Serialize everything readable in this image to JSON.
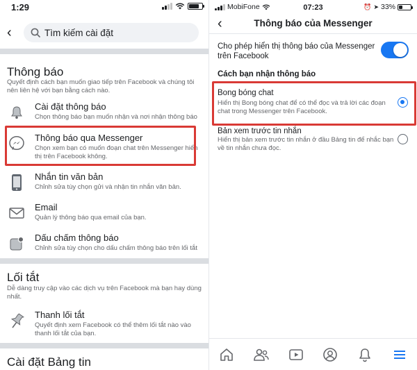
{
  "left": {
    "status": {
      "time": "1:29"
    },
    "search": {
      "placeholder": "Tìm kiếm cài đặt"
    },
    "notifications": {
      "title": "Thông báo",
      "description": "Quyết định cách bạn muốn giao tiếp trên Facebook và chúng tôi nên liên hệ với bạn bằng cách nào.",
      "items": [
        {
          "title": "Cài đặt thông báo",
          "desc": "Chọn thông báo bạn muốn nhận và nơi nhận thông báo",
          "icon": "bell-icon"
        },
        {
          "title": "Thông báo qua Messenger",
          "desc": "Chọn xem bạn có muốn đoạn chat trên Messenger hiển thị trên Facebook không.",
          "icon": "messenger-icon"
        },
        {
          "title": "Nhắn tin văn bản",
          "desc": "Chỉnh sửa tùy chọn gửi và nhận tin nhắn văn bản.",
          "icon": "phone-icon"
        },
        {
          "title": "Email",
          "desc": "Quản lý thông báo qua email của bạn.",
          "icon": "envelope-icon"
        },
        {
          "title": "Dấu chấm thông báo",
          "desc": "Chỉnh sửa tùy chọn cho dấu chấm thông báo trên lối tắt",
          "icon": "notification-dot-icon"
        }
      ]
    },
    "shortcuts": {
      "title": "Lối tắt",
      "description": "Dễ dàng truy cập vào các dịch vụ trên Facebook mà bạn hay dùng nhất.",
      "items": [
        {
          "title": "Thanh lối tắt",
          "desc": "Quyết định xem Facebook có thể thêm lối tắt nào vào thanh lối tắt của bạn.",
          "icon": "pin-icon"
        }
      ]
    },
    "news_feed": {
      "title": "Cài đặt Bảng tin"
    }
  },
  "right": {
    "status": {
      "carrier": "MobiFone",
      "time": "07:23",
      "battery": "33%",
      "battery_level": 0.33
    },
    "title": "Thông báo của Messenger",
    "toggle_label": "Cho phép hiển thị thông báo của Messenger trên Facebook",
    "toggle_on": true,
    "section_label": "Cách bạn nhận thông báo",
    "options": [
      {
        "title": "Bong bóng chat",
        "desc": "Hiển thị Bong bóng chat để có thể đọc và trả lời các đoạn chat trong Messenger trên Facebook.",
        "selected": true
      },
      {
        "title": "Bản xem trước tin nhắn",
        "desc": "Hiển thị bản xem trước tin nhắn ở đầu Bảng tin để nhắc bạn về tin nhắn chưa đọc.",
        "selected": false
      }
    ],
    "tabbar": [
      "home-icon",
      "friends-icon",
      "watch-icon",
      "profile-icon",
      "bell-icon",
      "menu-icon"
    ]
  },
  "colors": {
    "accent": "#1877f2",
    "highlight": "#d93a35",
    "secondary_text": "#65676b",
    "divider": "#dadde1"
  }
}
